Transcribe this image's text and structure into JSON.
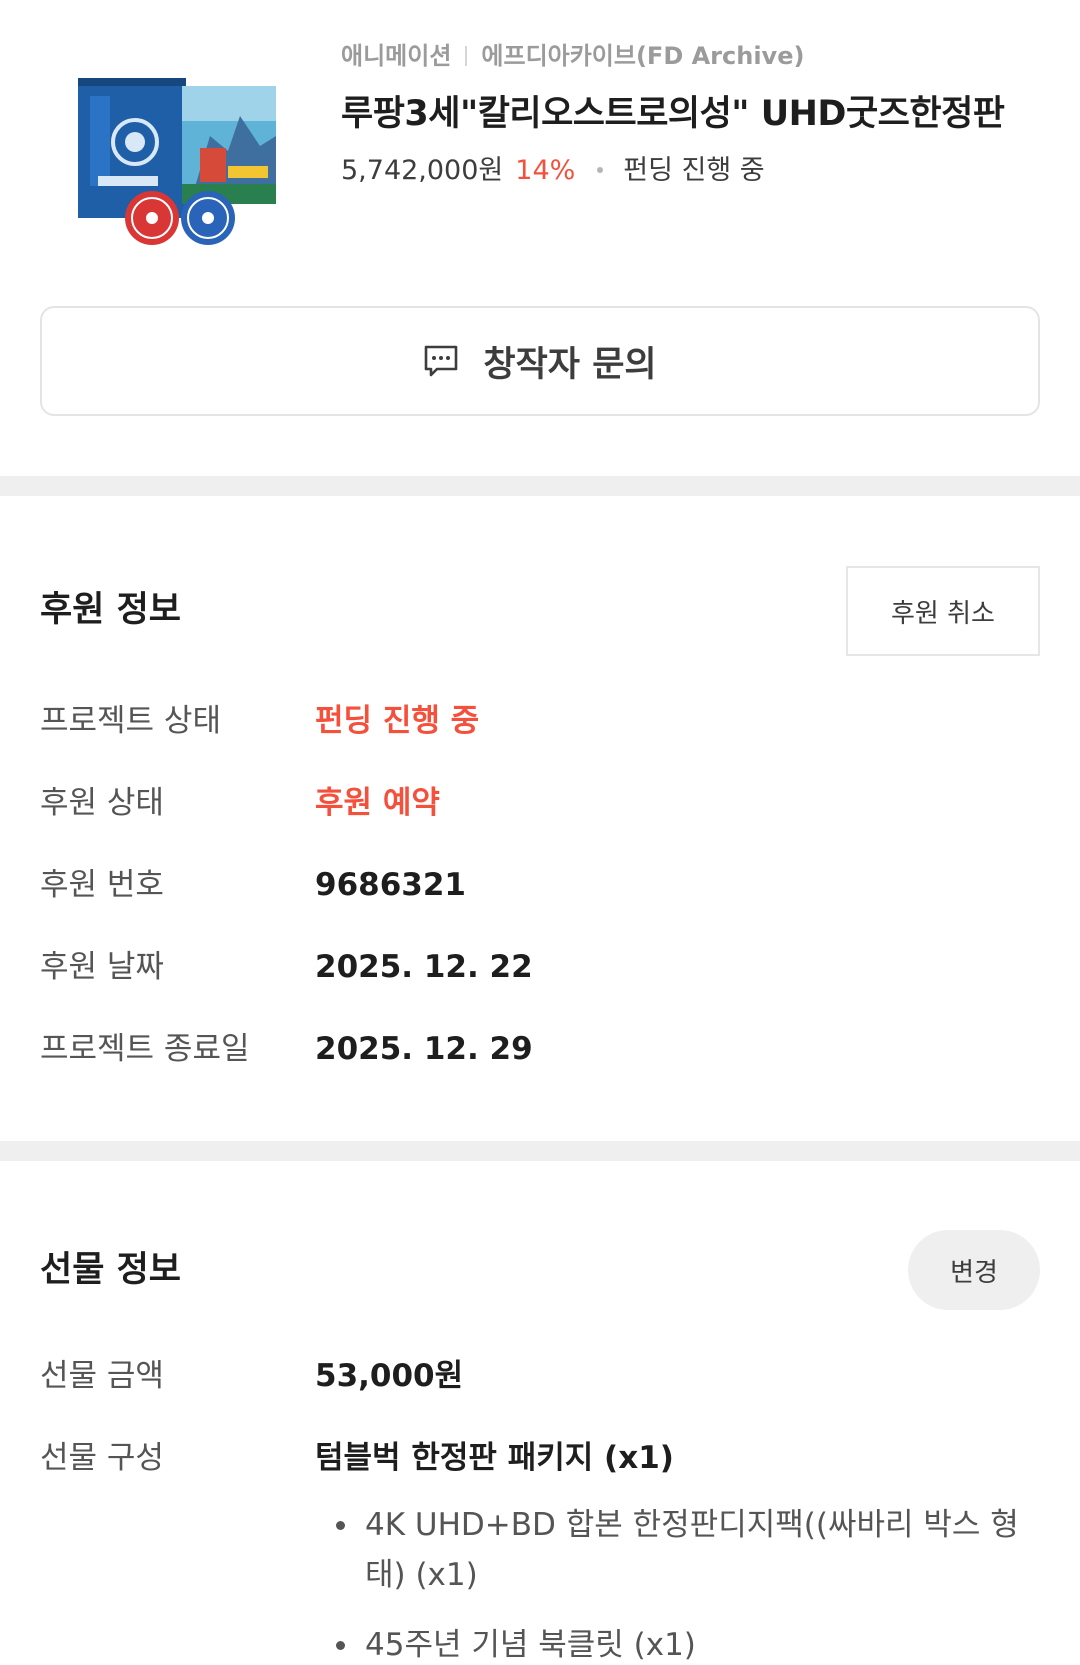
{
  "product": {
    "category": "애니메이션",
    "creator": "에프디아카이브(FD Archive)",
    "title": "루팡3세\"칼리오스트로의성\" UHD굿즈한정판",
    "amount": "5,742,000원",
    "rate": "14%",
    "status": "펀딩 진행 중"
  },
  "inquiry_button": {
    "label": "창작자 문의",
    "icon": "chat-bubble-icon"
  },
  "support_info": {
    "title": "후원 정보",
    "cancel_label": "후원 취소",
    "rows": [
      {
        "label": "프로젝트 상태",
        "value": "펀딩 진행 중"
      },
      {
        "label": "후원 상태",
        "value": "후원 예약"
      },
      {
        "label": "후원 번호",
        "value": "9686321"
      },
      {
        "label": "후원 날짜",
        "value": "2025. 12. 22"
      },
      {
        "label": "프로젝트 종료일",
        "value": "2025. 12. 29"
      }
    ]
  },
  "gift_info": {
    "title": "선물 정보",
    "change_label": "변경",
    "rows": [
      {
        "label": "선물 금액",
        "value": "53,000원"
      },
      {
        "label": "선물 구성",
        "value": "텀블벅 한정판 패키지 (x1)"
      }
    ],
    "items": [
      "4K UHD+BD 합본 한정판디지팩((싸바리 박스 형태) (x1)",
      "45주년 기념 북클릿 (x1)"
    ]
  },
  "colors": {
    "accent": "#f5503b",
    "divider": "#efefef",
    "muted": "#9b9b9b"
  }
}
